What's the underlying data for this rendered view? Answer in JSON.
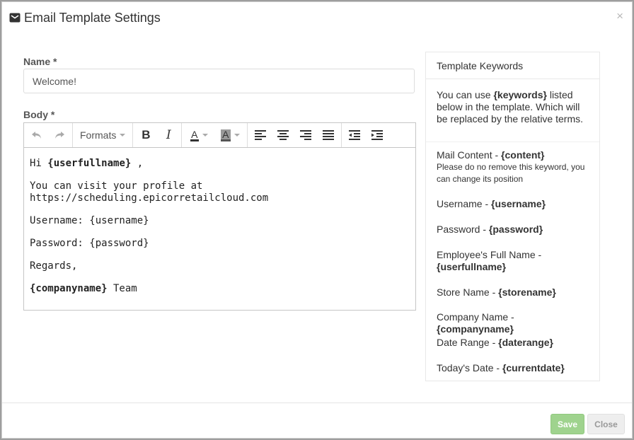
{
  "dialog": {
    "title": "Email Template Settings",
    "close_symbol": "×"
  },
  "form": {
    "name_label": "Name *",
    "name_value": "Welcome!",
    "body_label": "Body *"
  },
  "toolbar": {
    "formats_label": "Formats",
    "bold_label": "B",
    "italic_label": "I",
    "text_color_label": "A",
    "bg_color_label": "A"
  },
  "editor_content": {
    "line1_prefix": "Hi ",
    "line1_keyword": "{userfullname}",
    "line1_suffix": " ,",
    "line2": "You can visit your profile at https://scheduling.epicorretailcloud.com",
    "line3": "Username: {username}",
    "line4": "Password: {password}",
    "line5": "Regards,",
    "line6_keyword": "{companyname}",
    "line6_suffix": " Team"
  },
  "keywords_panel": {
    "title": "Template Keywords",
    "desc_prefix": "You can use ",
    "desc_keyword": "{keywords}",
    "desc_suffix": " listed below in the template. Which will be replaced by the relative terms.",
    "items": [
      {
        "label": "Mail Content - ",
        "keyword": "{content}",
        "note": "Please do no remove this keyword, you can change its position"
      },
      {
        "label": "Username - ",
        "keyword": "{username}"
      },
      {
        "label": "Password - ",
        "keyword": "{password}"
      },
      {
        "label": "Employee's Full Name - ",
        "keyword": "{userfullname}"
      },
      {
        "label": "Store Name - ",
        "keyword": "{storename}"
      },
      {
        "label": "Company Name - ",
        "keyword": "{companyname}"
      },
      {
        "label": "Date Range - ",
        "keyword": "{daterange}"
      },
      {
        "label": "Today's Date - ",
        "keyword": "{currentdate}"
      }
    ]
  },
  "footer": {
    "save_label": "Save",
    "close_label": "Close"
  },
  "colors": {
    "save_button": "#9fd38e",
    "close_button": "#eeeeee"
  }
}
